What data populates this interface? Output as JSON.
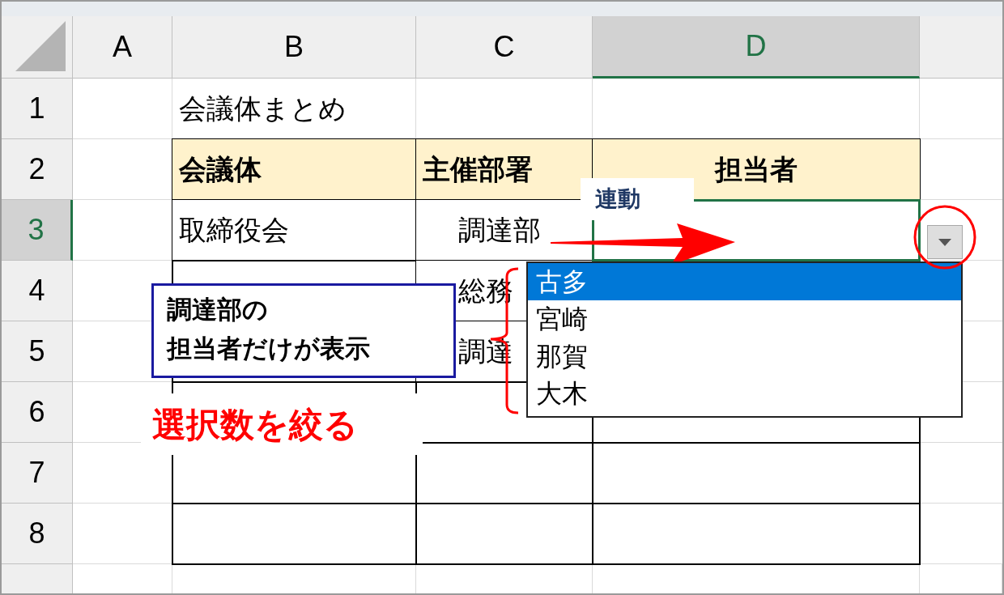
{
  "sheet": {
    "columns": [
      {
        "label": "A",
        "selected": false
      },
      {
        "label": "B",
        "selected": false
      },
      {
        "label": "C",
        "selected": false
      },
      {
        "label": "D",
        "selected": true
      }
    ],
    "rows": [
      {
        "label": "1",
        "selected": false,
        "cells": [
          {
            "kind": "none"
          },
          {
            "kind": "plain",
            "text": "会議体まとめ"
          },
          {
            "kind": "none"
          },
          {
            "kind": "none"
          }
        ]
      },
      {
        "label": "2",
        "selected": false,
        "cells": [
          {
            "kind": "none"
          },
          {
            "kind": "header",
            "text": "会議体"
          },
          {
            "kind": "header",
            "text": "主催部署"
          },
          {
            "kind": "header_center",
            "text": "担当者"
          }
        ]
      },
      {
        "label": "3",
        "selected": true,
        "cells": [
          {
            "kind": "none"
          },
          {
            "kind": "text",
            "text": "取締役会"
          },
          {
            "kind": "text_indent",
            "text": "調達部"
          },
          {
            "kind": "blank"
          }
        ]
      },
      {
        "label": "4",
        "selected": false,
        "cells": [
          {
            "kind": "none"
          },
          {
            "kind": "blank"
          },
          {
            "kind": "text_indent",
            "text": "総務"
          },
          {
            "kind": "covered"
          }
        ]
      },
      {
        "label": "5",
        "selected": false,
        "cells": [
          {
            "kind": "none"
          },
          {
            "kind": "blank"
          },
          {
            "kind": "text_indent",
            "text": "調達"
          },
          {
            "kind": "covered"
          }
        ]
      },
      {
        "label": "6",
        "selected": false,
        "cells": [
          {
            "kind": "none"
          },
          {
            "kind": "blank"
          },
          {
            "kind": "blank"
          },
          {
            "kind": "blank"
          }
        ]
      },
      {
        "label": "7",
        "selected": false,
        "cells": [
          {
            "kind": "none"
          },
          {
            "kind": "blank"
          },
          {
            "kind": "blank"
          },
          {
            "kind": "blank"
          }
        ]
      },
      {
        "label": "8",
        "selected": false,
        "cells": [
          {
            "kind": "none"
          },
          {
            "kind": "blank"
          },
          {
            "kind": "blank"
          },
          {
            "kind": "blank"
          }
        ]
      }
    ]
  },
  "dropdown": {
    "items": [
      {
        "text": "古多",
        "selected": true
      },
      {
        "text": "宮崎",
        "selected": false
      },
      {
        "text": "那賀",
        "selected": false
      },
      {
        "text": "大木",
        "selected": false
      }
    ]
  },
  "annotations": {
    "link_label": "連動",
    "note_lines": [
      "調達部の",
      "担当者だけが表示"
    ],
    "emphasis": "選択数を絞る"
  }
}
